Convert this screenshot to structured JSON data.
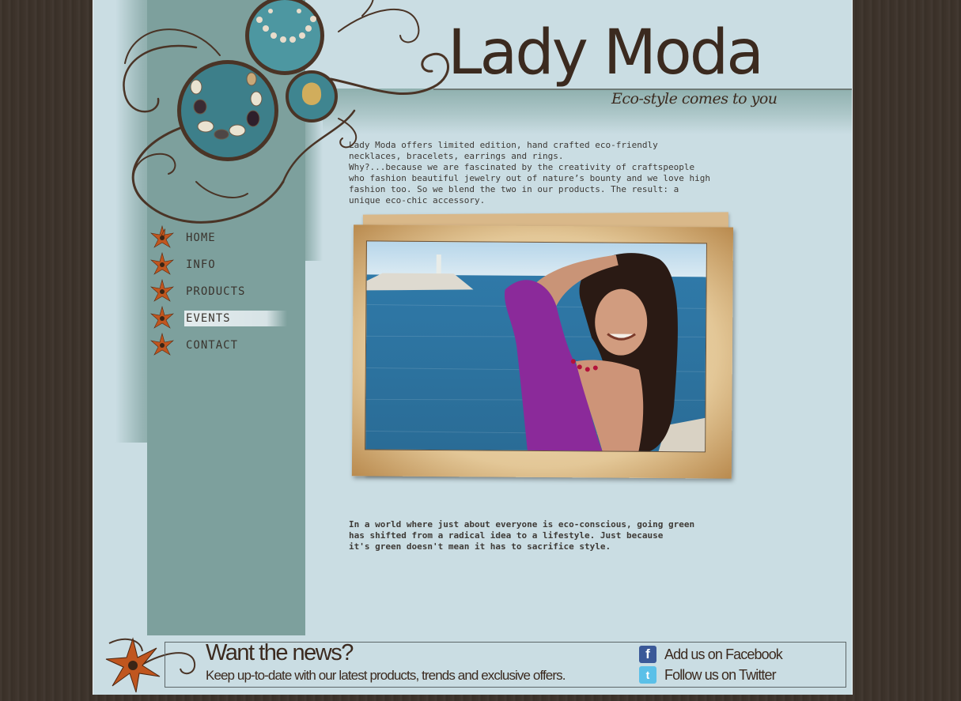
{
  "brand": {
    "title": "Lady Moda",
    "tagline": "Eco-style comes to you"
  },
  "intro": "Lady Moda offers limited edition, hand crafted eco-friendly\nnecklaces, bracelets, earrings and rings.\nWhy?...because we are fascinated by the creativity of craftspeople\nwho fashion beautiful jewelry out of nature’s bounty and we love high\nfashion too. So we blend the two in our products. The result: a\nunique eco-chic accessory.",
  "nav": {
    "items": [
      {
        "label": "HOME",
        "active": false
      },
      {
        "label": "INFO",
        "active": false
      },
      {
        "label": "PRODUCTS",
        "active": false
      },
      {
        "label": "EVENTS",
        "active": true
      },
      {
        "label": "CONTACT",
        "active": false
      }
    ]
  },
  "manifesto": "In a world where just about everyone is eco-conscious, going green\nhas shifted from a radical idea to a lifestyle. Just because\nit's green doesn't mean it has to sacrifice style.",
  "footer": {
    "news_title": "Want the news?",
    "news_subtitle": "Keep up-to-date with our latest products, trends and exclusive offers.",
    "facebook_label": "Add us on Facebook",
    "twitter_label": "Follow us on Twitter",
    "facebook_icon": "f",
    "twitter_icon": "t"
  },
  "colors": {
    "page_bg": "#cadde3",
    "sidebar": "#7da09d",
    "text_brown": "#3b2a1f",
    "accent_orange": "#c0561f",
    "wood": "#3c322a"
  },
  "icons": [
    "flower-star-icon",
    "facebook-icon",
    "twitter-icon"
  ]
}
